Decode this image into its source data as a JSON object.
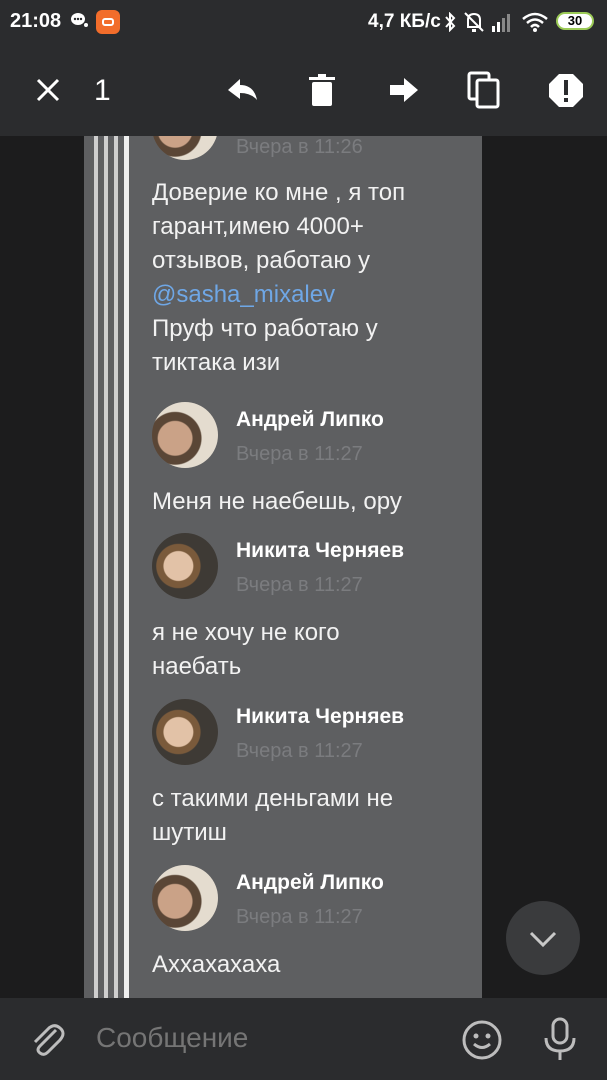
{
  "status_bar": {
    "time": "21:08",
    "net_speed": "4,7 КБ/с",
    "battery": "30",
    "icons": [
      "chat-bubble-icon",
      "screen-record-icon",
      "bluetooth-icon",
      "mute-bell-icon",
      "signal-icon",
      "wifi-icon",
      "battery-icon"
    ],
    "accent_color": "#f26d2b"
  },
  "action_bar": {
    "selected_count": "1",
    "icons": [
      "close-icon",
      "reply-icon",
      "delete-icon",
      "forward-icon",
      "copy-icon",
      "report-icon"
    ]
  },
  "messages": [
    {
      "type": "header",
      "time": "Вчера в 11:26"
    },
    {
      "type": "text",
      "lines": [
        "Доверие ко мне , я топ",
        "гарант,имею 4000+",
        "отзывов, работаю у"
      ],
      "mention": "@sasha_mixalev",
      "lines_after": [
        "Пруф что работаю у",
        "тиктака изи"
      ]
    },
    {
      "type": "header",
      "author": "Андрей Липко",
      "time": "Вчера в 11:27"
    },
    {
      "type": "text",
      "lines": [
        "Меня не наебешь, ору"
      ]
    },
    {
      "type": "header",
      "author": "Никита Черняев",
      "time": "Вчера в 11:27"
    },
    {
      "type": "text",
      "lines": [
        "я не хочу не кого",
        "наебать"
      ]
    },
    {
      "type": "header",
      "author": "Никита Черняев",
      "time": "Вчера в 11:27"
    },
    {
      "type": "text",
      "lines": [
        "с такими деньгами не",
        "шутиш"
      ]
    },
    {
      "type": "header",
      "author": "Андрей Липко",
      "time": "Вчера в 11:27"
    },
    {
      "type": "text",
      "lines": [
        "Аххахахаха"
      ]
    }
  ],
  "composer": {
    "placeholder": "Сообщение",
    "icons": [
      "attach-icon",
      "emoji-icon",
      "microphone-icon"
    ]
  },
  "colors": {
    "panel_bg": "#5e5f61",
    "bar_bg": "#2b2c2e",
    "mention": "#6fa7e6",
    "battery_green": "#9ccb57"
  }
}
